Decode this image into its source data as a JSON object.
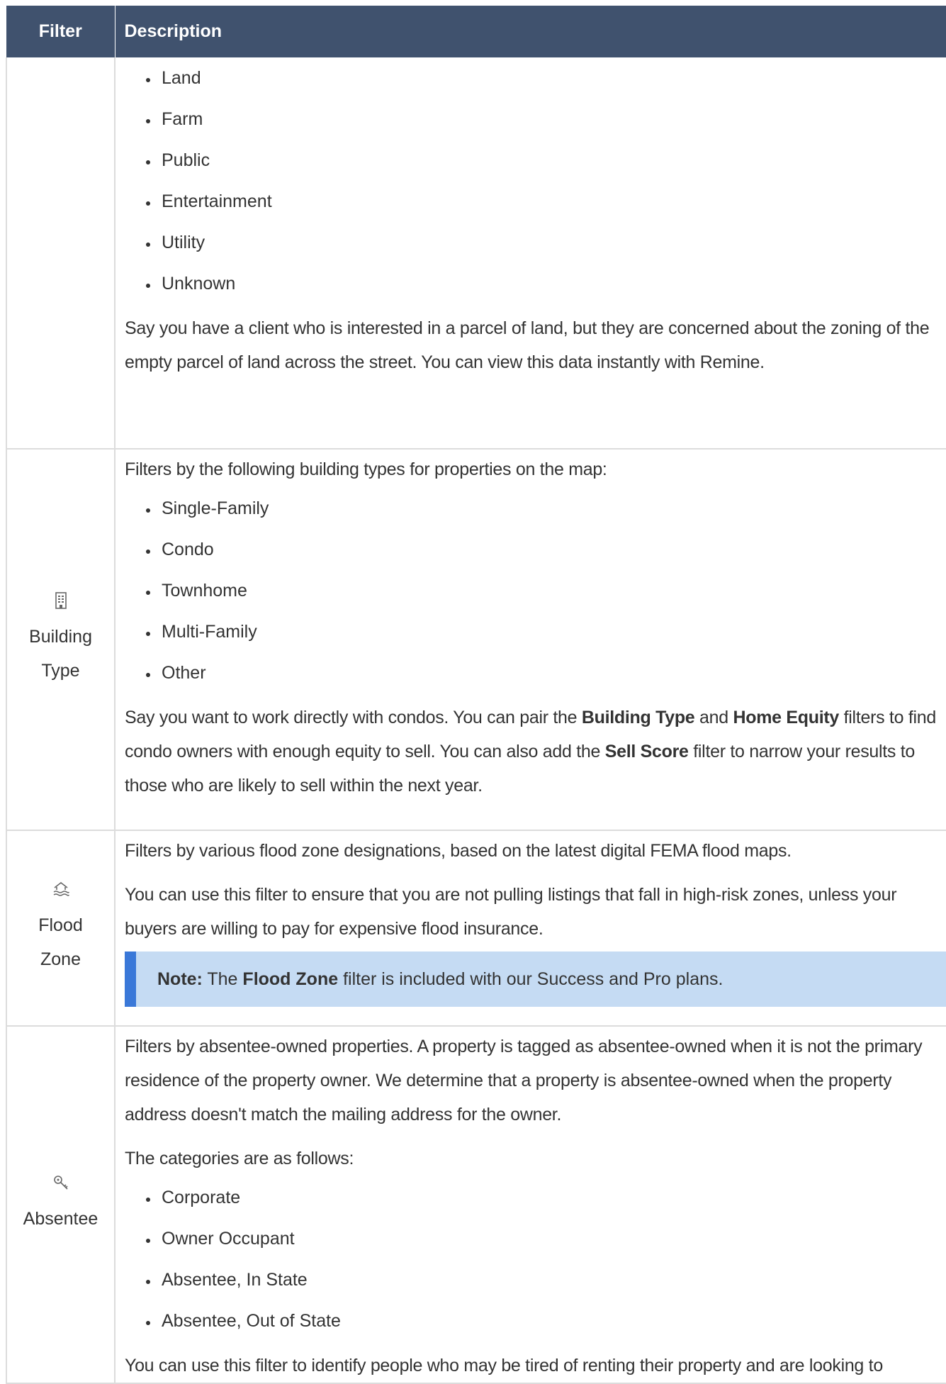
{
  "header": {
    "filter": "Filter",
    "description": "Description"
  },
  "rows": [
    {
      "list": [
        "Land",
        "Farm",
        "Public",
        "Entertainment",
        "Utility",
        "Unknown"
      ],
      "para": "Say you have a client who is interested in a parcel of land, but they are concerned about the zoning of the empty parcel of land across the street. You can view this data instantly with Remine."
    },
    {
      "filter_line1": "Building",
      "filter_line2": "Type",
      "icon": "building-icon",
      "intro": "Filters by the following building types for properties on the map:",
      "list": [
        "Single-Family",
        "Condo",
        "Townhome",
        "Multi-Family",
        "Other"
      ],
      "para_a": "Say you want to work directly with condos. You can pair the ",
      "bold_a": "Building Type",
      "para_b": " and ",
      "bold_b": "Home Equity",
      "para_c": " filters to find condo owners with enough equity to sell. You can also add the ",
      "bold_c": "Sell Score",
      "para_d": " filter to narrow your results to those who are likely to sell within the next year."
    },
    {
      "filter_line1": "Flood",
      "filter_line2": "Zone",
      "icon": "flood-icon",
      "intro": "Filters by various flood zone designations, based on the latest digital FEMA flood maps.",
      "para": "You can use this filter to ensure that you are not pulling listings that fall in high-risk zones, unless your buyers are willing to pay for expensive flood insurance.",
      "note_label": "Note:",
      "note_a": " The ",
      "note_bold": "Flood Zone",
      "note_b": " filter is included with our Success and Pro plans."
    },
    {
      "filter_line1": "Absentee",
      "icon": "key-icon",
      "intro": "Filters by absentee-owned properties. A property is tagged as absentee-owned when it is not the primary residence of the property owner. We determine that a property is absentee-owned when the property address doesn't match the mailing address for the owner.",
      "categories_intro": "The categories are as follows:",
      "list": [
        "Corporate",
        "Owner Occupant",
        "Absentee, In State",
        "Absentee, Out of State"
      ],
      "para": "You can use this filter to identify people who may be tired of renting their property and are looking to"
    }
  ]
}
